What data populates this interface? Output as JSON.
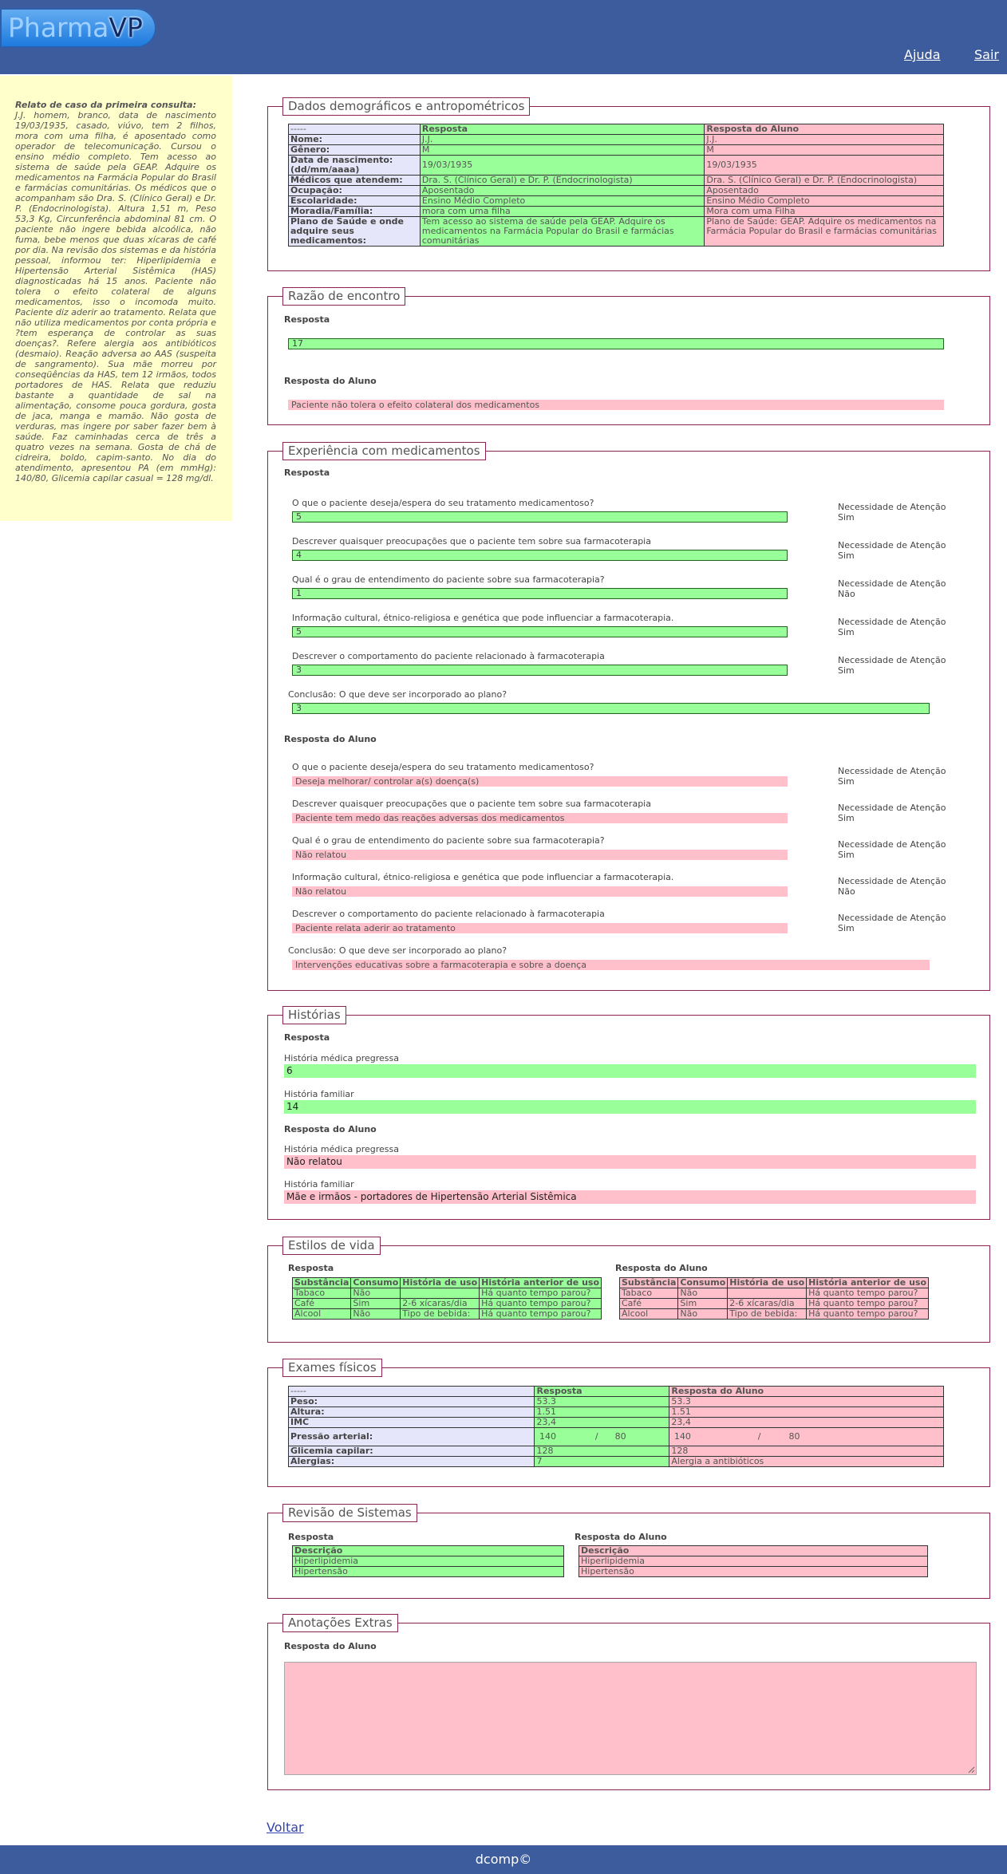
{
  "header": {
    "logo_part1": "Pharma",
    "logo_part2": "VP",
    "help": "Ajuda",
    "logout": "Sair"
  },
  "case": {
    "title": "Relato de caso da primeira consulta:",
    "text": "J.J. homem, branco, data de nascimento 19/03/1935, casado, viúvo, tem 2 filhos, mora com uma filha, é aposentado como operador de telecomunicação. Cursou o ensino médio completo. Tem acesso ao sistema de saúde pela GEAP. Adquire os medicamentos na Farmácia Popular do Brasil e farmácias comunitárias. Os médicos que o acompanham são Dra. S. (Clínico Geral) e Dr. P. (Endocrinologista). Altura 1,51 m, Peso 53,3 Kg, Circunferência abdominal 81 cm. O paciente não ingere bebida alcoólica, não fuma, bebe menos que duas xícaras de café por dia. Na revisão dos sistemas e da história pessoal, informou ter: Hiperlipidemia e Hipertensão Arterial Sistêmica (HAS) diagnosticadas há 15 anos. Paciente não tolera o efeito colateral de alguns medicamentos, isso o incomoda muito. Paciente diz aderir ao tratamento. Relata que não utiliza medicamentos por conta própria e ?tem esperança de controlar as suas doenças?. Refere alergia aos antibióticos (desmaio). Reação adversa ao AAS (suspeita de sangramento). Sua mãe morreu por conseqüências da HAS, tem 12 irmãos, todos portadores de HAS. Relata que reduziu bastante a quantidade de sal na alimentação, consome pouca gordura, gosta de jaca, manga e mamão. Não gosta de verduras, mas ingere por saber fazer bem à saúde. Faz caminhadas cerca de três a quatro vezes na semana. Gosta de chá de cidreira, boldo, capim-santo. No dia do atendimento, apresentou PA (em mmHg): 140/80, Glicemia capilar casual = 128 mg/dl."
  },
  "demo": {
    "legend": "Dados demográficos e antropométricos",
    "head": [
      "-----",
      "Resposta",
      "Resposta do Aluno"
    ],
    "rows": [
      {
        "label": "Nome:",
        "resp": "J.J.",
        "aluno": "J.J."
      },
      {
        "label": "Gênero:",
        "resp": "M",
        "aluno": "M"
      },
      {
        "label": "Data de nascimento: (dd/mm/aaaa)",
        "resp": "19/03/1935",
        "aluno": "19/03/1935"
      },
      {
        "label": "Médicos que atendem:",
        "resp": "Dra. S. (Clínico Geral) e Dr. P. (Endocrinologista)",
        "aluno": "Dra. S. (Clínico Geral) e Dr. P. (Endocrinologista)"
      },
      {
        "label": "Ocupação:",
        "resp": "Aposentado",
        "aluno": "Aposentado"
      },
      {
        "label": "Escolaridade:",
        "resp": "Ensino Médio Completo",
        "aluno": "Ensino Médio Completo"
      },
      {
        "label": "Moradia/Família:",
        "resp": "mora com uma filha",
        "aluno": "Mora com uma Filha"
      },
      {
        "label": "Plano de Saúde e onde adquire seus medicamentos:",
        "resp": "Tem acesso ao sistema de saúde pela GEAP. Adquire os medicamentos na Farmácia Popular do Brasil e farmácias comunitárias",
        "aluno": "Plano de Saúde: GEAP. Adquire os medicamentos na Farmácia Popular do Brasil e farmácias comunitárias"
      }
    ]
  },
  "reason": {
    "legend": "Razão de encontro",
    "resp_label": "Resposta",
    "resp_value": "17",
    "aluno_label": "Resposta do Aluno",
    "aluno_value": "Paciente não tolera o efeito colateral dos medicamentos"
  },
  "exp": {
    "legend": "Experiência com medicamentos",
    "resp_label": "Resposta",
    "aluno_label": "Resposta do Aluno",
    "need_label": "Necessidade de Atenção",
    "conclusion_q": "Conclusão: O que deve ser incorporado ao plano?",
    "items": [
      {
        "q": "O que o paciente deseja/espera do seu tratamento medicamentoso?",
        "resp": "5",
        "resp_need": "Sim",
        "aluno": "Deseja melhorar/ controlar a(s) doença(s)",
        "aluno_need": "Sim"
      },
      {
        "q": "Descrever quaisquer preocupações que o paciente tem sobre sua farmacoterapia",
        "resp": "4",
        "resp_need": "Sim",
        "aluno": "Paciente tem medo das reações adversas dos medicamentos",
        "aluno_need": "Sim"
      },
      {
        "q": "Qual é o grau de entendimento do paciente sobre sua farmacoterapia?",
        "resp": "1",
        "resp_need": "Não",
        "aluno": "Não relatou",
        "aluno_need": "Sim"
      },
      {
        "q": "Informação cultural, étnico-religiosa e genética que pode influenciar a farmacoterapia.",
        "resp": "5",
        "resp_need": "Sim",
        "aluno": "Não relatou",
        "aluno_need": "Não"
      },
      {
        "q": "Descrever o comportamento do paciente relacionado à farmacoterapia",
        "resp": "3",
        "resp_need": "Sim",
        "aluno": "Paciente relata aderir ao tratamento",
        "aluno_need": "Sim"
      }
    ],
    "conclusion_resp": "3",
    "conclusion_aluno": "Intervenções educativas sobre a farmacoterapia e sobre a doença"
  },
  "hist": {
    "legend": "Histórias",
    "resp_label": "Resposta",
    "aluno_label": "Resposta do Aluno",
    "med_label": "História médica pregressa",
    "fam_label": "História familiar",
    "resp_med": "6",
    "resp_fam": "14",
    "aluno_med": "Não relatou",
    "aluno_fam": "Mãe e irmãos - portadores de Hipertensão Arterial Sistêmica"
  },
  "life": {
    "legend": "Estilos de vida",
    "resp_label": "Resposta",
    "aluno_label": "Resposta do Aluno",
    "head": [
      "Substância",
      "Consumo",
      "História de uso",
      "História anterior de uso"
    ],
    "resp_rows": [
      [
        "Tabaco",
        "Não",
        "",
        "Há quanto tempo parou?"
      ],
      [
        "Café",
        "Sim",
        "2-6 xícaras/dia",
        "Há quanto tempo parou?"
      ],
      [
        "Álcool",
        "Não",
        "Tipo de bebida:",
        "Há quanto tempo parou?"
      ]
    ],
    "aluno_rows": [
      [
        "Tabaco",
        "Não",
        "",
        "Há quanto tempo parou?"
      ],
      [
        "Café",
        "Sim",
        "2-6 xícaras/dia",
        "Há quanto tempo parou?"
      ],
      [
        "Álcool",
        "Não",
        "Tipo de bebida:",
        "Há quanto tempo parou?"
      ]
    ]
  },
  "exams": {
    "legend": "Exames físicos",
    "head": [
      "-----",
      "Resposta",
      "Resposta do Aluno"
    ],
    "rows": [
      {
        "label": "Peso:",
        "resp": "53.3",
        "aluno": "53.3"
      },
      {
        "label": "Altura:",
        "resp": "1.51",
        "aluno": "1.51"
      },
      {
        "label": "IMC",
        "resp": "23,4",
        "aluno": "23,4"
      }
    ],
    "pa_label": "Pressão arterial:",
    "pa_resp": {
      "sys": "140",
      "sep": "/",
      "dia": "80"
    },
    "pa_aluno": {
      "sys": "140",
      "sep": "/",
      "dia": "80"
    },
    "gly_label": "Glicemia capilar:",
    "gly_resp": "128",
    "gly_aluno": "128",
    "allergy_label": "Alergias:",
    "allergy_resp": "7",
    "allergy_aluno": "Alergia a antibióticos"
  },
  "review": {
    "legend": "Revisão de Sistemas",
    "resp_label": "Resposta",
    "aluno_label": "Resposta do Aluno",
    "head": "Descrição",
    "resp_items": [
      "Hiperlipidemia",
      "Hipertensão"
    ],
    "aluno_items": [
      "Hiperlipidemia",
      "Hipertensão"
    ]
  },
  "notes": {
    "legend": "Anotações Extras",
    "aluno_label": "Resposta do Aluno",
    "value": ""
  },
  "nav": {
    "back": "Voltar"
  },
  "footer": {
    "text": "dcomp©"
  },
  "colors": {
    "header_bg": "#3d5c9e",
    "case_bg": "#ffffcc",
    "resp_green": "#99ff99",
    "aluno_pink": "#ffc0cb",
    "border": "#8b2252"
  }
}
